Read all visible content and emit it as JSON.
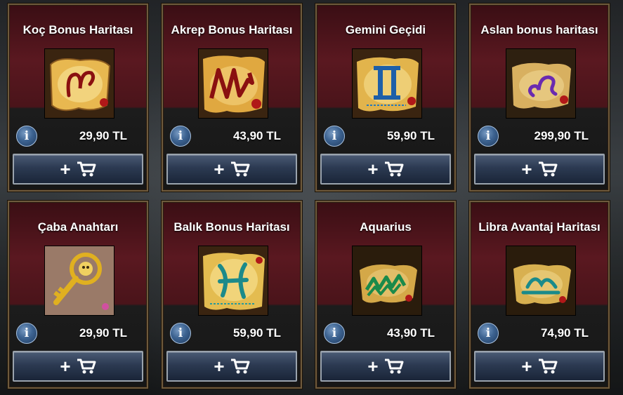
{
  "store": {
    "info_glyph": "i",
    "cart_icon": "plus-cart-icon",
    "items": [
      {
        "title": "Koç Bonus Haritası",
        "price": "29,90 TL",
        "image": "aries-map"
      },
      {
        "title": "Akrep Bonus Haritası",
        "price": "43,90 TL",
        "image": "scorpio-map"
      },
      {
        "title": "Gemini Geçidi",
        "price": "59,90 TL",
        "image": "gemini-map"
      },
      {
        "title": "Aslan bonus haritası",
        "price": "299,90 TL",
        "image": "leo-map"
      },
      {
        "title": "Çaba Anahtarı",
        "price": "29,90 TL",
        "image": "golden-key"
      },
      {
        "title": "Balık Bonus Haritası",
        "price": "59,90 TL",
        "image": "pisces-map"
      },
      {
        "title": "Aquarius",
        "price": "43,90 TL",
        "image": "aquarius-map"
      },
      {
        "title": "Libra Avantaj Haritası",
        "price": "74,90 TL",
        "image": "libra-map"
      }
    ]
  },
  "colors": {
    "card_top": "#5a1820",
    "card_border": "#6e5a3c",
    "button_blue": "#2c3a52",
    "info_blue": "#3d6391"
  }
}
